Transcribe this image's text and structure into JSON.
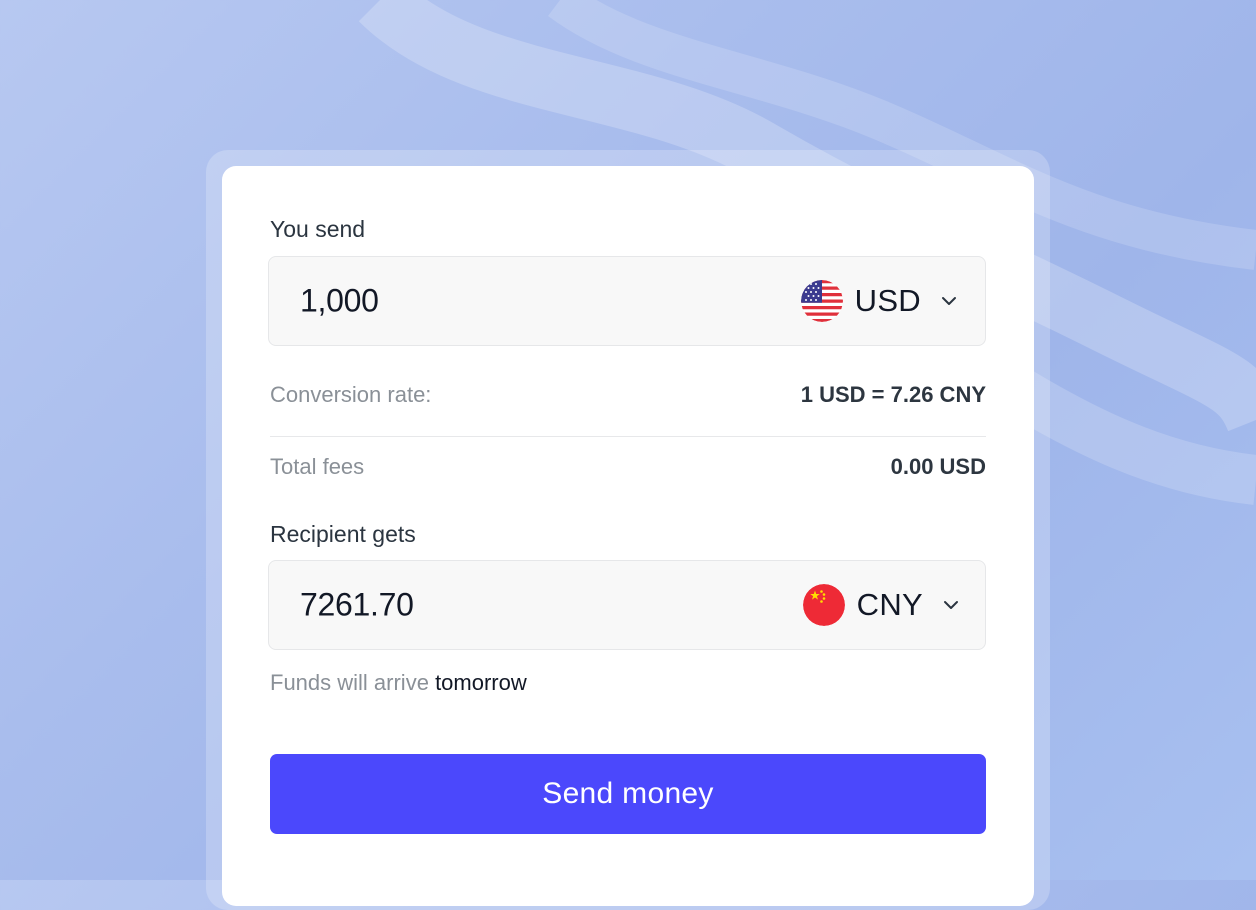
{
  "send": {
    "label": "You send",
    "amount": "1,000",
    "currency": "USD",
    "flag_icon": "us-flag-icon"
  },
  "conversion": {
    "label": "Conversion rate:",
    "value": "1 USD = 7.26 CNY"
  },
  "fees": {
    "label": "Total fees",
    "value": "0.00 USD"
  },
  "receive": {
    "label": "Recipient gets",
    "amount": "7261.70",
    "currency": "CNY",
    "flag_icon": "china-flag-icon"
  },
  "arrival": {
    "prefix": "Funds will arrive",
    "when": "tomorrow"
  },
  "actions": {
    "send_label": "Send money"
  },
  "colors": {
    "accent": "#4b48fc",
    "background": "#a9bded",
    "card": "#ffffff",
    "input_bg": "#f8f8f8"
  }
}
